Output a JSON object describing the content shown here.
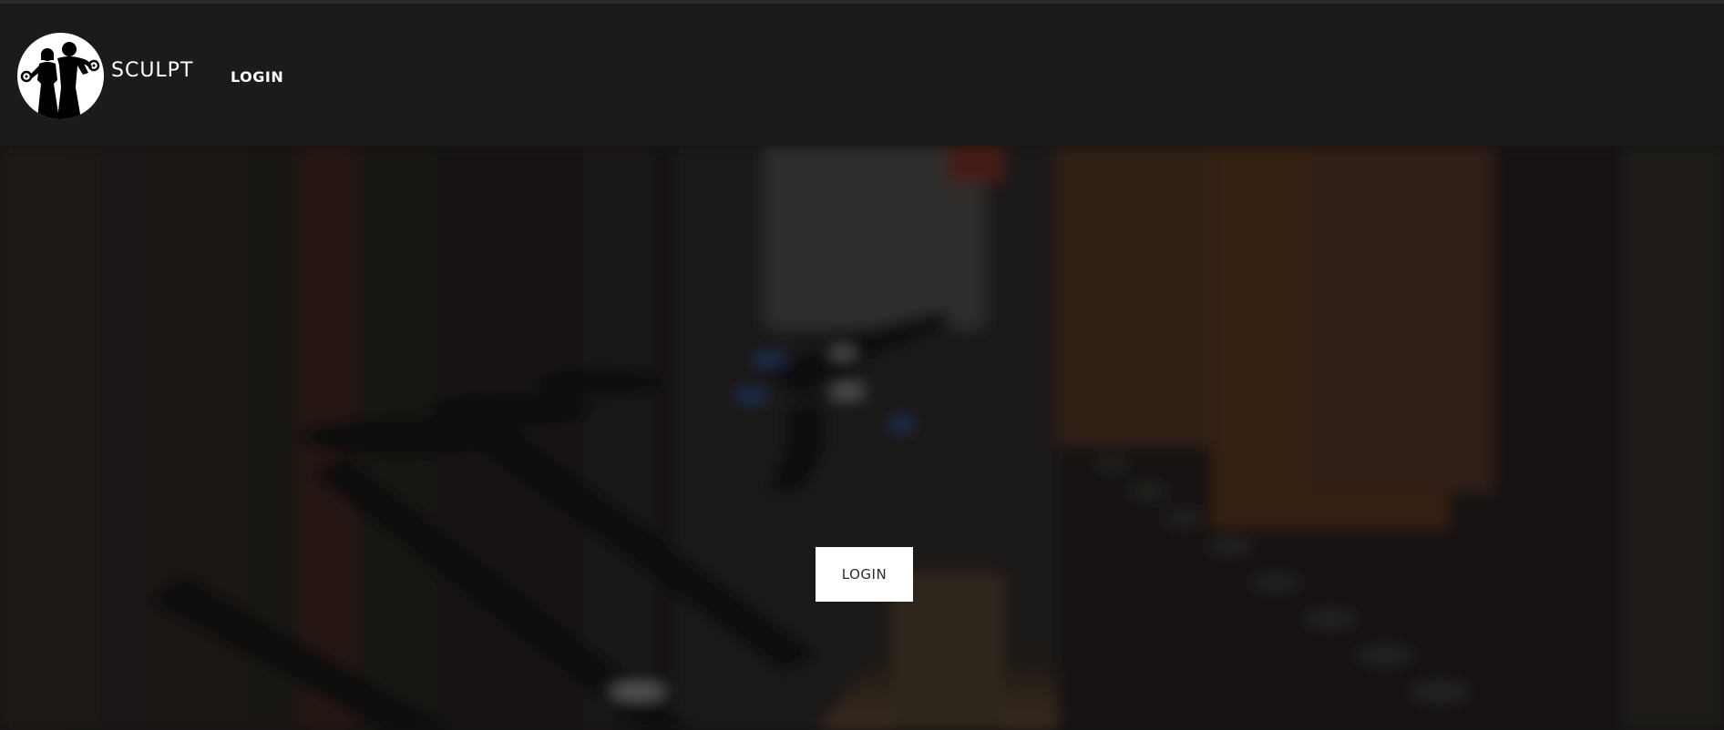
{
  "header": {
    "brand": "SCULPT",
    "nav_login": "LOGIN",
    "logo_icon": "fitness-couple-dumbbells-icon"
  },
  "hero": {
    "login_button": "LOGIN",
    "background": "blurred gym spin bikes photo"
  },
  "colors": {
    "navbar": "#1b1b1b",
    "button_bg": "#ffffff",
    "button_text": "#2b2b2b"
  }
}
